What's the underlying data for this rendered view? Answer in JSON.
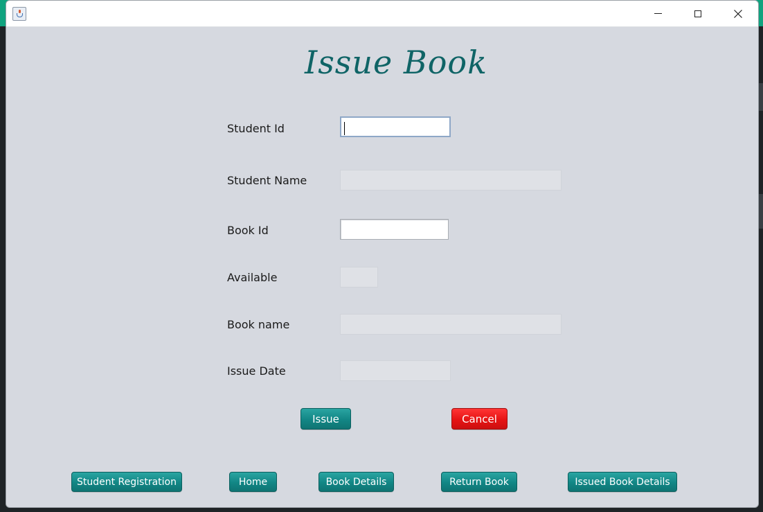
{
  "window": {
    "title": "",
    "controls": {
      "minimize": "minimize-icon",
      "maximize": "maximize-icon",
      "close": "close-icon"
    }
  },
  "heading": "Issue Book",
  "form": {
    "student_id": {
      "label": "Student Id",
      "value": ""
    },
    "student_name": {
      "label": "Student Name",
      "value": ""
    },
    "book_id": {
      "label": "Book Id",
      "value": ""
    },
    "available": {
      "label": "Available",
      "value": ""
    },
    "book_name": {
      "label": "Book name",
      "value": ""
    },
    "issue_date": {
      "label": "Issue Date",
      "value": ""
    }
  },
  "actions": {
    "issue": "Issue",
    "cancel": "Cancel"
  },
  "nav": {
    "student_registration": "Student Registration",
    "home": "Home",
    "book_details": "Book Details",
    "return_book": "Return Book",
    "issued_book_details": "Issued Book Details"
  },
  "colors": {
    "heading": "#0f6466",
    "button_teal": "#128685",
    "button_red": "#e61414",
    "window_bg": "#d6d9e0"
  }
}
